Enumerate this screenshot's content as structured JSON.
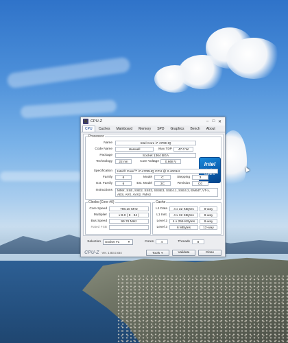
{
  "window": {
    "title": "CPU-Z",
    "minimize": "–",
    "maximize": "□",
    "close": "✕"
  },
  "tabs": [
    "CPU",
    "Caches",
    "Mainboard",
    "Memory",
    "SPD",
    "Graphics",
    "Bench",
    "About"
  ],
  "processor": {
    "legend": "Processor",
    "name_label": "Name",
    "name": "Intel Core i7 4700HQ",
    "codename_label": "Code Name",
    "codename": "Haswell",
    "maxtdp_label": "Max TDP",
    "maxtdp": "47.0 W",
    "package_label": "Package",
    "package": "Socket 1364 BGA",
    "technology_label": "Technology",
    "technology": "22 nm",
    "corevoltage_label": "Core Voltage",
    "corevoltage": "0.668 V",
    "specification_label": "Specification",
    "specification": "Intel® Core™ i7-4700HQ CPU @ 2.40GHz",
    "family_label": "Family",
    "family": "6",
    "model_label": "Model",
    "model": "C",
    "stepping_label": "Stepping",
    "stepping": "3",
    "extfamily_label": "Ext. Family",
    "extfamily": "6",
    "extmodel_label": "Ext. Model",
    "extmodel": "3C",
    "revision_label": "Revision",
    "revision": "C0",
    "instructions_label": "Instructions",
    "instructions": "MMX, SSE, SSE2, SSE3, SSSE3, SSE4.1, SSE4.2, EM64T, VT-x, AES, AVX, AVX2, FMA3"
  },
  "intel_logo": {
    "brand": "intel",
    "inside": "inside",
    "model": "CORE i7"
  },
  "clocks": {
    "legend": "Clocks (Core #0)",
    "corespeed_label": "Core Speed",
    "corespeed": "798.10 MHz",
    "multiplier_label": "Multiplier",
    "multiplier": "x 8.0 ( 8 - 34 )",
    "busspeed_label": "Bus Speed",
    "busspeed": "99.76 MHz",
    "ratedfsb_label": "Rated FSB",
    "ratedfsb": ""
  },
  "cache": {
    "legend": "Cache",
    "rows": [
      {
        "label": "L1 Data",
        "size": "4 x 32 KBytes",
        "ways": "8-way"
      },
      {
        "label": "L1 Inst.",
        "size": "4 x 32 KBytes",
        "ways": "8-way"
      },
      {
        "label": "Level 2",
        "size": "4 x 256 KBytes",
        "ways": "8-way"
      },
      {
        "label": "Level 3",
        "size": "6 MBytes",
        "ways": "12-way"
      }
    ]
  },
  "selection": {
    "label": "Selection",
    "value": "Socket #1",
    "cores_label": "Cores",
    "cores": "4",
    "threads_label": "Threads",
    "threads": "8"
  },
  "footer": {
    "brand": "CPU-Z",
    "version": "Ver. 1.83.0.x64",
    "tools_label": "Tools",
    "validate_label": "Validate",
    "close_label": "Close"
  }
}
